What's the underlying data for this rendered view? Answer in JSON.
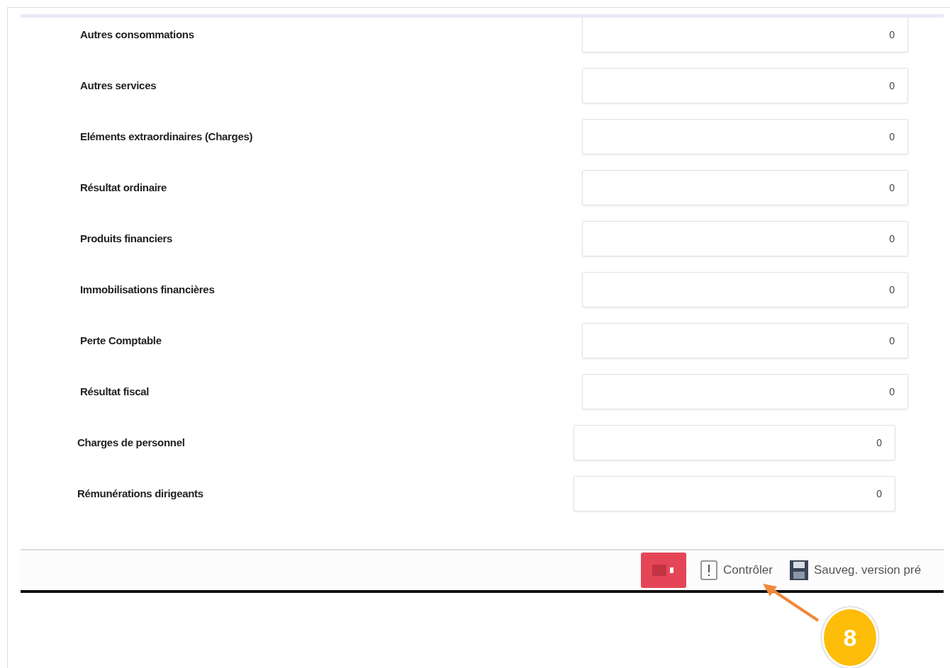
{
  "sections": [
    {
      "fields": [
        {
          "label": "Autres consommations",
          "value": "0"
        },
        {
          "label": "Autres services",
          "value": "0"
        },
        {
          "label": "Eléments extraordinaires (Charges)",
          "value": "0"
        },
        {
          "label": "Résultat ordinaire",
          "value": "0"
        },
        {
          "label": "Produits financiers",
          "value": "0"
        },
        {
          "label": "Immobilisations financières",
          "value": "0"
        },
        {
          "label": "Perte Comptable",
          "value": "0"
        },
        {
          "label": "Résultat fiscal",
          "value": "0"
        }
      ]
    },
    {
      "fields": [
        {
          "label": "Charges de personnel",
          "value": "0"
        },
        {
          "label": "Rémunérations dirigeants",
          "value": "0"
        }
      ]
    }
  ],
  "toolbar": [
    {
      "kind": "danger"
    },
    {
      "kind": "check",
      "label": "Contrôler"
    },
    {
      "kind": "save",
      "label": "Sauveg. version pré"
    }
  ],
  "callout": {
    "number": "8"
  }
}
